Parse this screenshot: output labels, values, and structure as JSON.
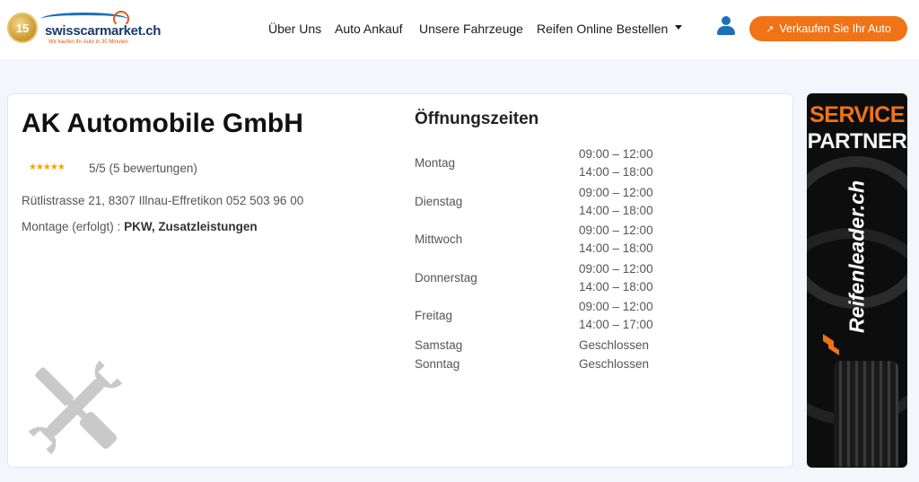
{
  "header": {
    "logo": {
      "badge_text": "15",
      "brand": "swisscarmarket.ch",
      "tagline": "Wir kaufen Ihr Auto in 30 Minuten"
    },
    "nav": [
      "Über Uns",
      "Auto Ankauf",
      "Unsere Fahrzeuge",
      "Reifen Online Bestellen"
    ],
    "user_icon": "user-icon",
    "cta": {
      "label": "Verkaufen Sie Ihr Auto",
      "icon": "arrow-up-right-icon",
      "color": "#f07315"
    }
  },
  "business": {
    "name": "AK Automobile GmbH",
    "stars": "★★★★★",
    "rating_text": "5/5 (5 bewertungen)",
    "address": "Rütlistrasse 21, 8307 Illnau-Effretikon 052 503 96 00",
    "montage_label": "Montage (erfolgt) : ",
    "montage_value": "PKW, Zusatzleistungen",
    "placeholder_icon": "wrench-screwdriver-icon"
  },
  "hours": {
    "title": "Öffnungszeiten",
    "rows": [
      {
        "day": "Montag",
        "times": [
          "09:00 – 12:00",
          "14:00 – 18:00"
        ]
      },
      {
        "day": "Dienstag",
        "times": [
          "09:00 – 12:00",
          "14:00 – 18:00"
        ]
      },
      {
        "day": "Mittwoch",
        "times": [
          "09:00 – 12:00",
          "14:00 – 18:00"
        ]
      },
      {
        "day": "Donnerstag",
        "times": [
          "09:00 – 12:00",
          "14:00 – 18:00"
        ]
      },
      {
        "day": "Freitag",
        "times": [
          "09:00 – 12:00",
          "14:00 – 17:00"
        ]
      },
      {
        "day": "Samstag",
        "times": [
          "Geschlossen"
        ]
      },
      {
        "day": "Sonntag",
        "times": [
          "Geschlossen"
        ]
      }
    ]
  },
  "ad": {
    "line1": "SERVICE",
    "line2": "PARTNER",
    "brand": "Reifenleader.ch",
    "accent": "#f07315"
  }
}
